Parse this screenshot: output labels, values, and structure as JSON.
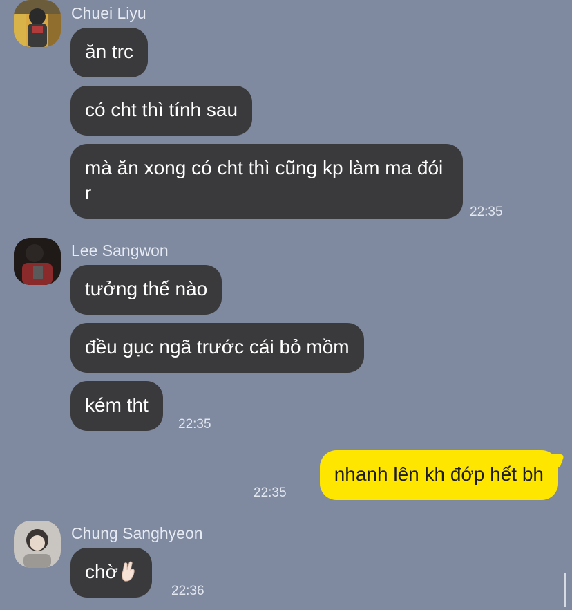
{
  "colors": {
    "background": "#7f8aa0",
    "incoming_bubble": "#3a3a3c",
    "outgoing_bubble": "#ffe600",
    "name_text": "#e7ebf3",
    "time_text": "#e3e7ef"
  },
  "messages": {
    "group1": {
      "sender": "Chuei Liyu",
      "texts": [
        "ăn trc",
        "có cht thì tính sau",
        "mà ăn xong có cht thì cũng kp làm ma đói r"
      ],
      "time": "22:35"
    },
    "group2": {
      "sender": "Lee Sangwon",
      "texts": [
        "tưởng thế nào",
        "đều gục ngã trước cái bỏ mồm",
        "kém tht"
      ],
      "time": "22:35"
    },
    "group3": {
      "text": "nhanh lên kh đớp hết bh",
      "time": "22:35"
    },
    "group4": {
      "sender": "Chung Sanghyeon",
      "text": "chờ",
      "emoji_icon": "pinching-hand-emoji",
      "time": "22:36"
    }
  }
}
